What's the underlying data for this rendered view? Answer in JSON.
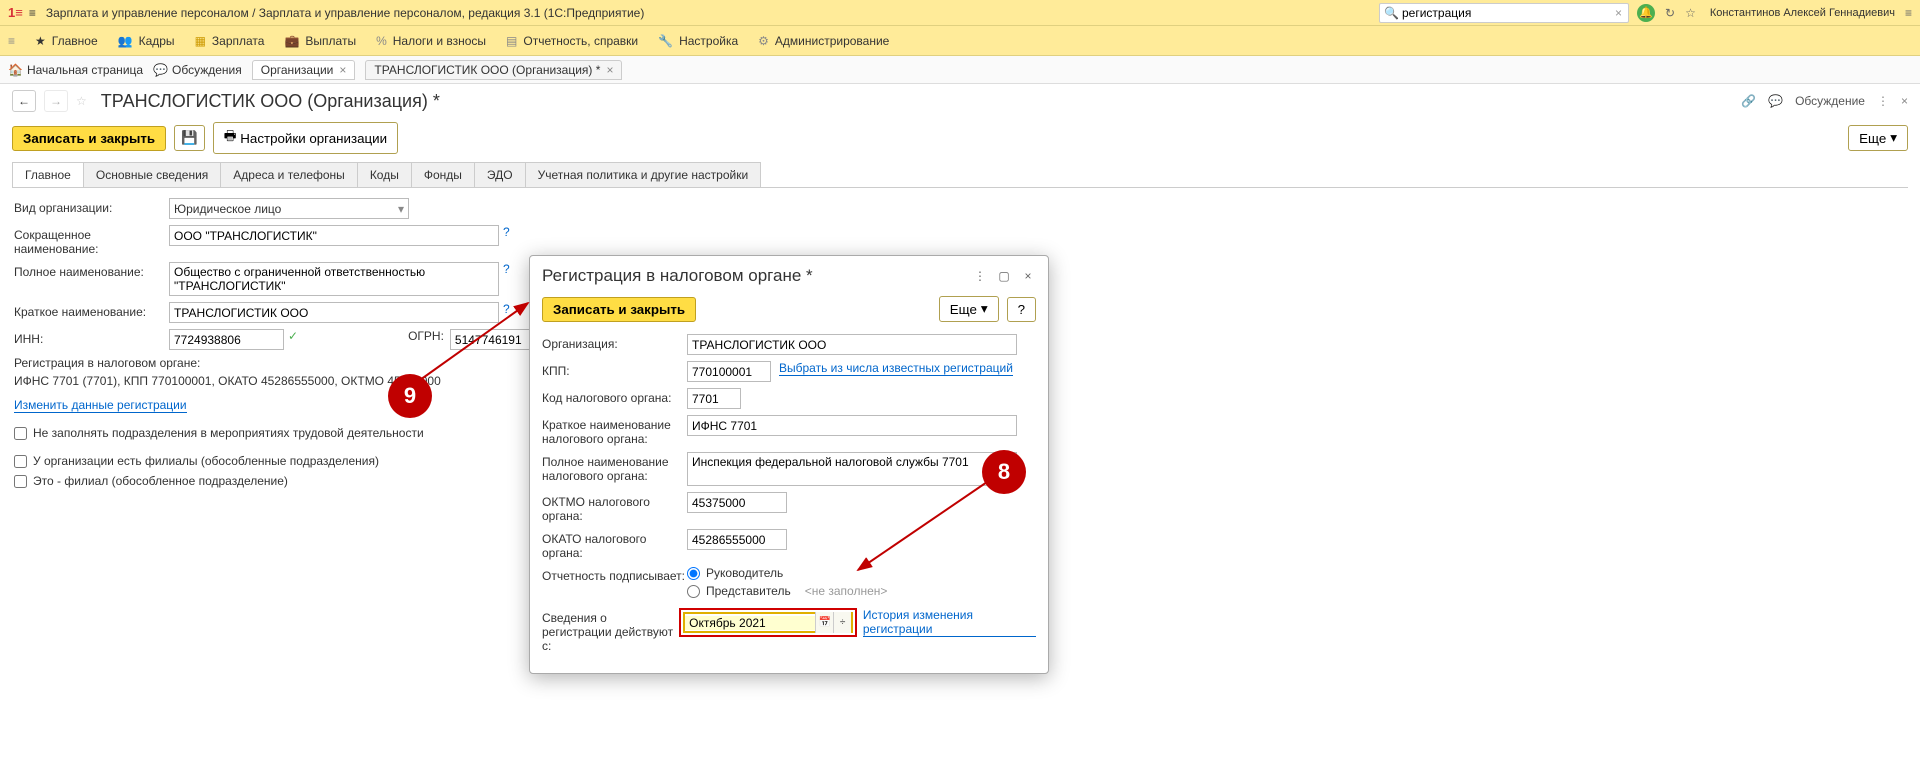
{
  "topbar": {
    "app_title": "Зарплата и управление персоналом / Зарплата и управление персоналом, редакция 3.1  (1С:Предприятие)",
    "search_value": "регистрация",
    "user": "Константинов Алексей Геннадиевич"
  },
  "mainmenu": {
    "items": [
      "Главное",
      "Кадры",
      "Зарплата",
      "Выплаты",
      "Налоги и взносы",
      "Отчетность, справки",
      "Настройка",
      "Администрирование"
    ]
  },
  "tabs": {
    "home": "Начальная страница",
    "discussions": "Обсуждения",
    "organizations": "Организации",
    "current": "ТРАНСЛОГИСТИК ООО (Организация) *"
  },
  "page": {
    "title": "ТРАНСЛОГИСТИК ООО (Организация) *",
    "discussion": "Обсуждение"
  },
  "toolbar": {
    "save_close": "Записать и закрыть",
    "org_settings": "Настройки организации",
    "more": "Еще"
  },
  "formtabs": [
    "Главное",
    "Основные сведения",
    "Адреса и телефоны",
    "Коды",
    "Фонды",
    "ЭДО",
    "Учетная политика и другие настройки"
  ],
  "form": {
    "org_type_label": "Вид организации:",
    "org_type_value": "Юридическое лицо",
    "short_name_label": "Сокращенное наименование:",
    "short_name_value": "ООО \"ТРАНСЛОГИСТИК\"",
    "full_name_label": "Полное наименование:",
    "full_name_value": "Общество с ограниченной ответственностью \"ТРАНСЛОГИСТИК\"",
    "brief_name_label": "Краткое наименование:",
    "brief_name_value": "ТРАНСЛОГИСТИК ООО",
    "inn_label": "ИНН:",
    "inn_value": "7724938806",
    "ogrn_label": "ОГРН:",
    "ogrn_value": "5147746191",
    "reg_header": "Регистрация в налоговом органе:",
    "reg_summary": "ИФНС 7701 (7701), КПП 770100001, ОКАТО 45286555000, ОКТМО 45375000",
    "change_reg_link": "Изменить данные регистрации",
    "chk_not_fill": "Не заполнять подразделения в мероприятиях трудовой деятельности",
    "chk_branches": "У организации есть филиалы (обособленные подразделения)",
    "chk_is_branch": "Это - филиал (обособленное подразделение)"
  },
  "dialog": {
    "title": "Регистрация в налоговом органе *",
    "save_close": "Записать и закрыть",
    "more": "Еще",
    "org_label": "Организация:",
    "org_value": "ТРАНСЛОГИСТИК ООО",
    "kpp_label": "КПП:",
    "kpp_value": "770100001",
    "select_known_link": "Выбрать из числа известных регистраций",
    "tax_code_label": "Код налогового органа:",
    "tax_code_value": "7701",
    "tax_short_label": "Краткое наименование налогового органа:",
    "tax_short_value": "ИФНС 7701",
    "tax_full_label": "Полное наименование налогового органа:",
    "tax_full_value": "Инспекция федеральной налоговой службы 7701",
    "oktmo_label": "ОКТМО налогового органа:",
    "oktmo_value": "45375000",
    "okato_label": "ОКАТО налогового органа:",
    "okato_value": "45286555000",
    "signer_label": "Отчетность подписывает:",
    "signer_head": "Руководитель",
    "signer_rep": "Представитель",
    "not_filled": "<не заполнен>",
    "effective_label": "Сведения о регистрации действуют с:",
    "effective_value": "Октябрь 2021",
    "history_link": "История изменения регистрации"
  },
  "annotations": {
    "n8": "8",
    "n9": "9"
  }
}
